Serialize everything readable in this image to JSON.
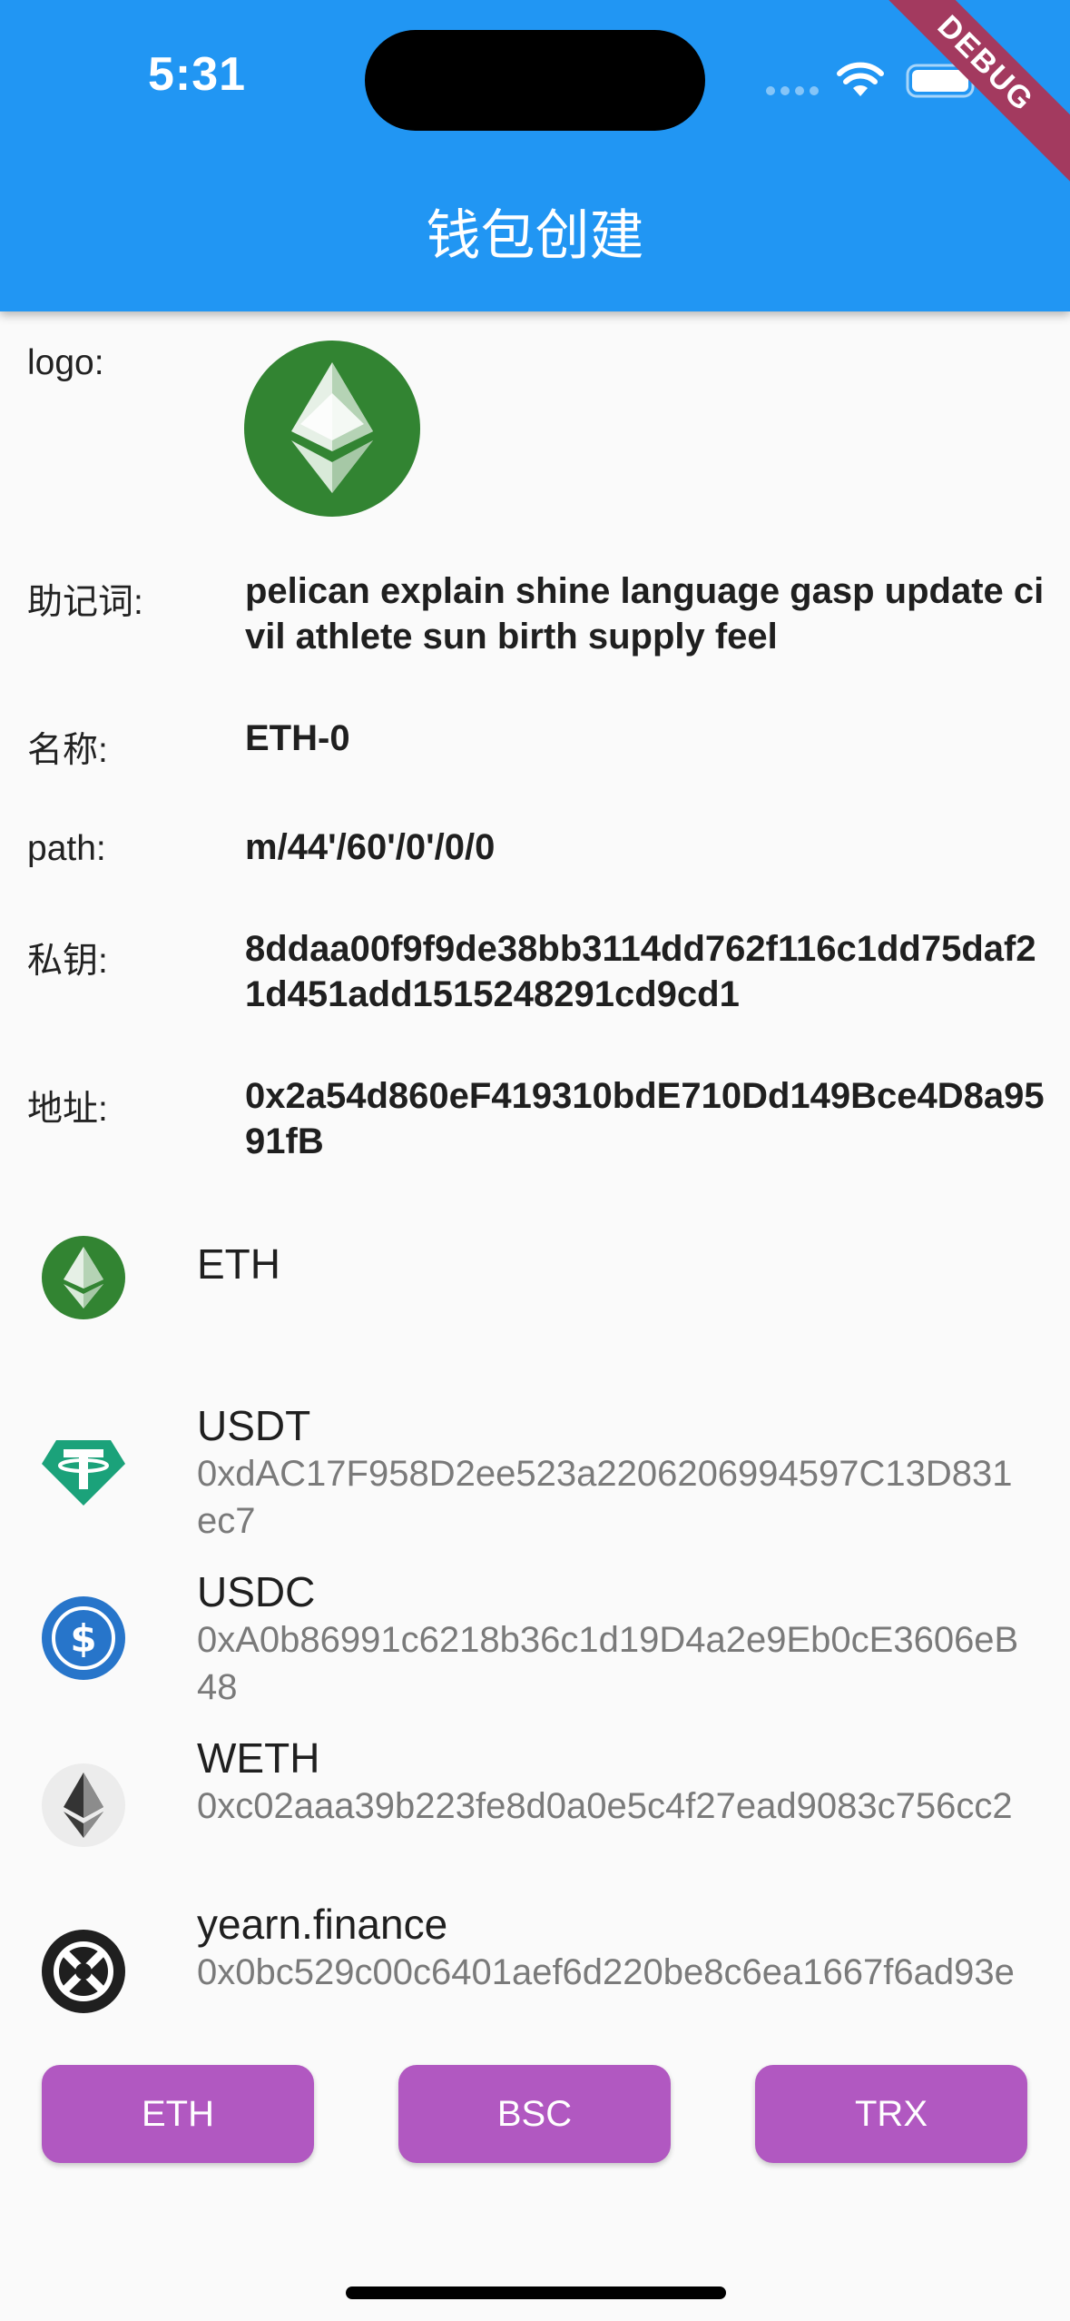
{
  "status_bar": {
    "time": "5:31",
    "debug_label": "DEBUG"
  },
  "app_bar": {
    "title": "钱包创建"
  },
  "wallet": {
    "logo_label": "logo:",
    "mnemonic_label": "助记词:",
    "mnemonic": "pelican explain shine language gasp update civil athlete sun birth supply feel",
    "name_label": "名称:",
    "name": "ETH-0",
    "path_label": "path:",
    "path": "m/44'/60'/0'/0/0",
    "private_key_label": "私钥:",
    "private_key": "8ddaa00f9f9de38bb3114dd762f116c1dd75daf21d451add1515248291cd9cd1",
    "address_label": "地址:",
    "address": "0x2a54d860eF419310bdE710Dd149Bce4D8a9591fB"
  },
  "tokens": [
    {
      "name": "ETH",
      "address": "",
      "icon": "ethereum-classic-icon"
    },
    {
      "name": "USDT",
      "address": "0xdAC17F958D2ee523a2206206994597C13D831ec7",
      "icon": "tether-icon"
    },
    {
      "name": "USDC",
      "address": "0xA0b86991c6218b36c1d19D4a2e9Eb0cE3606eB48",
      "icon": "usdc-icon"
    },
    {
      "name": "WETH",
      "address": "0xc02aaa39b223fe8d0a0e5c4f27ead9083c756cc2",
      "icon": "weth-icon"
    },
    {
      "name": "yearn.finance",
      "address": "0x0bc529c00c6401aef6d220be8c6ea1667f6ad93e",
      "icon": "yearn-icon"
    }
  ],
  "chain_buttons": [
    "ETH",
    "BSC",
    "TRX"
  ],
  "colors": {
    "app_bar": "#2196f3",
    "button": "#b158c1",
    "eth_green": "#328432",
    "tether_teal": "#1ba27a",
    "usdc_blue": "#2775ca"
  }
}
